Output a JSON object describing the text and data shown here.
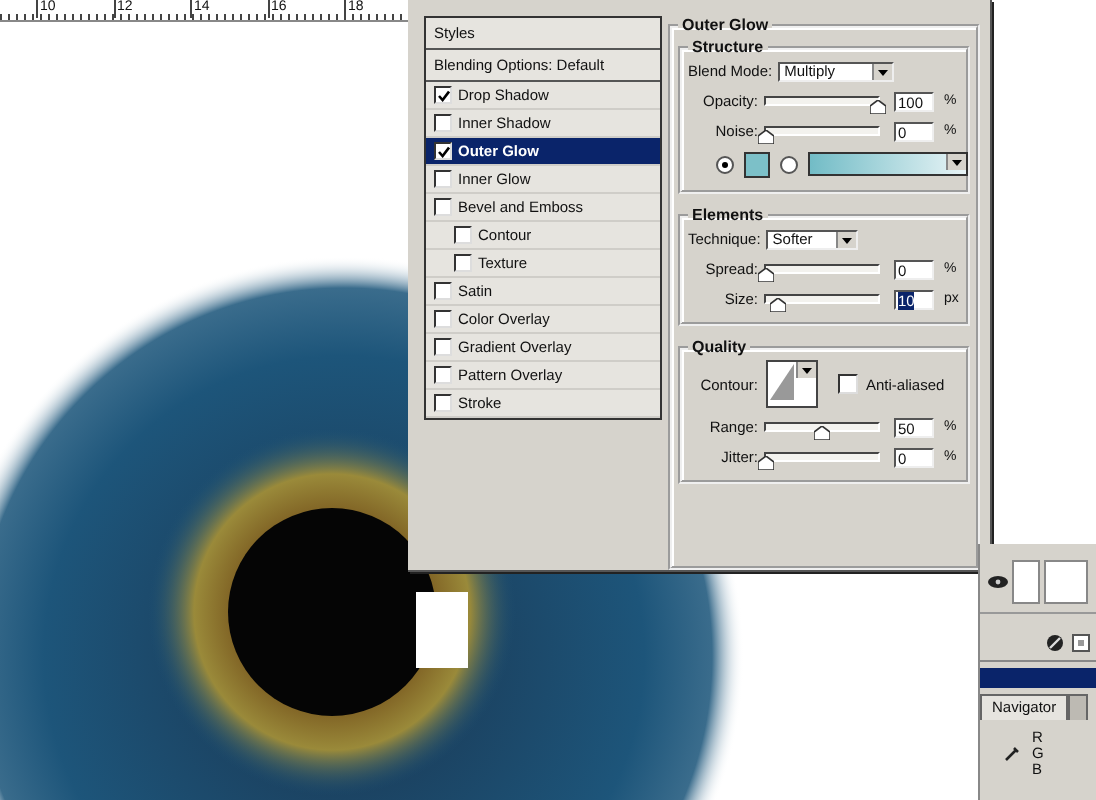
{
  "ruler": {
    "ticks": [
      "10",
      "12",
      "14",
      "16",
      "18"
    ]
  },
  "styles_list": {
    "header": "Styles",
    "blending": "Blending Options: Default",
    "items": [
      {
        "label": "Drop Shadow",
        "checked": true,
        "selected": false
      },
      {
        "label": "Inner Shadow",
        "checked": false,
        "selected": false
      },
      {
        "label": "Outer Glow",
        "checked": true,
        "selected": true
      },
      {
        "label": "Inner Glow",
        "checked": false,
        "selected": false
      },
      {
        "label": "Bevel and Emboss",
        "checked": false,
        "selected": false,
        "children": [
          {
            "label": "Contour",
            "checked": false,
            "selected": false
          },
          {
            "label": "Texture",
            "checked": false,
            "selected": false
          }
        ]
      },
      {
        "label": "Satin",
        "checked": false,
        "selected": false
      },
      {
        "label": "Color Overlay",
        "checked": false,
        "selected": false
      },
      {
        "label": "Gradient Overlay",
        "checked": false,
        "selected": false
      },
      {
        "label": "Pattern Overlay",
        "checked": false,
        "selected": false
      },
      {
        "label": "Stroke",
        "checked": false,
        "selected": false
      }
    ]
  },
  "outer_glow": {
    "title": "Outer Glow",
    "structure": {
      "title": "Structure",
      "blend_mode_label": "Blend Mode:",
      "blend_mode": "Multiply",
      "sliders": [
        {
          "label": "Opacity:",
          "level": 1,
          "value": "100",
          "unit": "%",
          "value_selected": false
        },
        {
          "label": "Noise:",
          "level": 0,
          "value": "0",
          "unit": "%",
          "value_selected": false
        }
      ],
      "fill_options": [
        {
          "kind": "color",
          "selected": true
        },
        {
          "kind": "gradient",
          "selected": false
        }
      ]
    },
    "elements": {
      "title": "Elements",
      "technique_label": "Technique:",
      "technique": "Softer",
      "sliders": [
        {
          "label": "Spread:",
          "level": 0,
          "value": "0",
          "unit": "%",
          "value_selected": false
        },
        {
          "label": "Size:",
          "level": 0.1,
          "value": "10",
          "unit": "px",
          "value_selected": true
        }
      ]
    },
    "quality": {
      "title": "Quality",
      "contour_label": "Contour:",
      "anti_aliased": {
        "label": "Anti-aliased",
        "checked": false
      },
      "sliders": [
        {
          "label": "Range:",
          "level": 0.5,
          "value": "50",
          "unit": "%",
          "value_selected": false
        },
        {
          "label": "Jitter:",
          "level": 0,
          "value": "0",
          "unit": "%",
          "value_selected": false
        }
      ]
    }
  },
  "palette": {
    "tabs": [
      {
        "label": "Navigator",
        "selected": true
      }
    ],
    "info_labels": [
      "R",
      "G",
      "B"
    ]
  }
}
